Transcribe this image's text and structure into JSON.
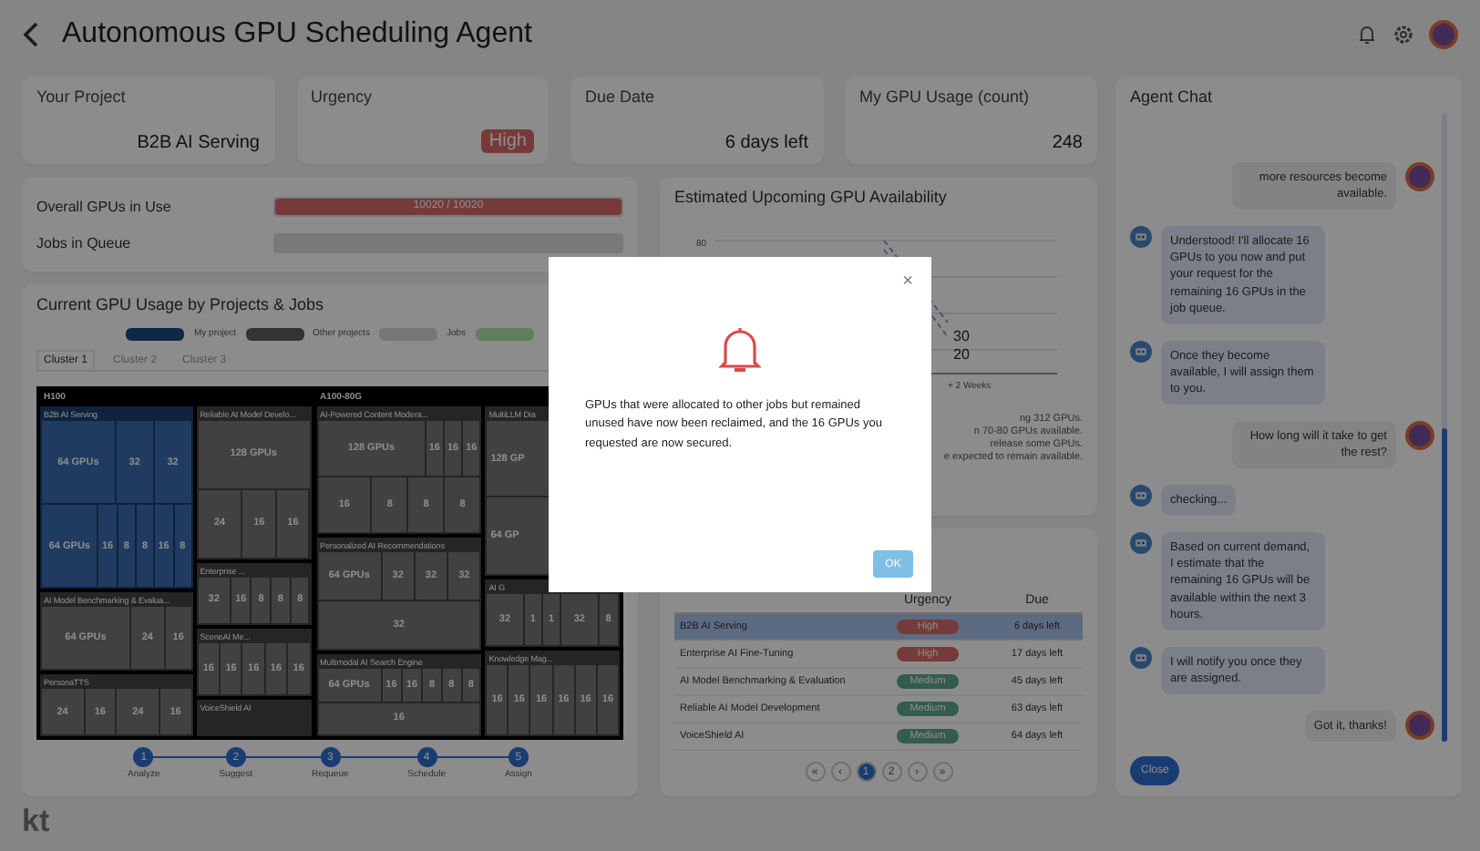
{
  "header": {
    "title": "Autonomous GPU Scheduling Agent"
  },
  "stats": [
    {
      "label": "Your Project",
      "value": "B2B AI Serving",
      "kind": "text"
    },
    {
      "label": "Urgency",
      "value": "High",
      "kind": "badge"
    },
    {
      "label": "Due Date",
      "value": "6 days left",
      "kind": "text"
    },
    {
      "label": "My GPU Usage (count)",
      "value": "248",
      "kind": "text"
    }
  ],
  "gpu_status": [
    {
      "label": "Overall GPUs in Use",
      "reading": "10020 / 10020",
      "level": 1
    },
    {
      "label": "Jobs in Queue"
    }
  ],
  "usage": {
    "title": "Current GPU Usage by Projects & Jobs",
    "legend": [
      {
        "label": "My project",
        "color": "#0f2847"
      },
      {
        "label": "Other projects",
        "color": "#333333"
      },
      {
        "label": "Jobs",
        "color": "#777777"
      },
      {
        "color": "#5f7f5f"
      }
    ],
    "tabs": [
      {
        "label": "Cluster 1",
        "selected": true
      },
      {
        "label": "Cluster 2",
        "selected": false
      },
      {
        "label": "Cluster 3",
        "selected": false
      }
    ],
    "clusters": [
      {
        "name": "H100",
        "columns": [
          [
            {
              "name": "B2B AI Serving",
              "mine": true,
              "tiles": [
                "64 GPUs",
                "32",
                "32",
                "64 GPUs",
                "16",
                "8",
                "8",
                "16",
                "8"
              ]
            },
            {
              "name": "AI Model Benchmarking & Evalua...",
              "mine": false,
              "tiles": [
                "64 GPUs",
                "24",
                "16"
              ]
            },
            {
              "name": "PersonaTTS",
              "mine": false,
              "tiles": [
                "24",
                "16",
                "24",
                "16"
              ]
            }
          ],
          [
            {
              "name": "Reliable AI Model Develo...",
              "mine": false,
              "tiles": [
                "128 GPUs",
                "24",
                "16",
                "16"
              ]
            },
            {
              "name": "Enterprise ...",
              "mine": false,
              "tiles": [
                "32",
                "16",
                "8",
                "8",
                "8"
              ]
            },
            {
              "name": "SceneAI Me...",
              "mine": false,
              "tiles": [
                "16",
                "16",
                "16",
                "16",
                "16"
              ]
            },
            {
              "name": "VoiceShield AI",
              "mine": false
            }
          ]
        ]
      },
      {
        "name": "A100-80G",
        "columns": [
          [
            {
              "name": "AI-Powered Content Modera...",
              "mine": false,
              "tiles": [
                "128 GPUs",
                "16",
                "16",
                "16",
                "16",
                "8",
                "8",
                "8"
              ]
            },
            {
              "name": "Personalized AI Recommendations",
              "mine": false,
              "tiles": [
                "64 GPUs",
                "32",
                "32",
                "32",
                "32"
              ]
            },
            {
              "name": "Multimodal AI Search Engine",
              "mine": false,
              "tiles": [
                "64 GPUs",
                "16",
                "16",
                "8",
                "8",
                "8",
                "16"
              ]
            }
          ],
          [
            {
              "name": "MultiLLM Dia",
              "mine": false,
              "tiles": [
                "128 GP",
                "64 GP"
              ]
            },
            {
              "name": "AI G",
              "mine": false,
              "tiles": [
                "32",
                "1",
                "1",
                "32",
                "8"
              ]
            },
            {
              "name": "Knowledge Mag...",
              "mine": false,
              "tiles": [
                "16",
                "16",
                "16",
                "16",
                "16",
                "16"
              ]
            }
          ]
        ]
      }
    ],
    "steps": [
      {
        "number": "1",
        "label": "Analyze"
      },
      {
        "number": "2",
        "label": "Suggest"
      },
      {
        "number": "3",
        "label": "Requeue"
      },
      {
        "number": "4",
        "label": "Schedule"
      },
      {
        "number": "5",
        "label": "Assign"
      }
    ]
  },
  "availability": {
    "title": "Estimated Upcoming GPU Availability",
    "ytick": "80",
    "point_labels": [
      "30",
      "20"
    ],
    "xtick": "+ 2 Weeks",
    "notes": [
      "ng 312 GPUs.",
      "n 70-80 GPUs available.",
      "release some GPUs.",
      "e expected to remain available."
    ]
  },
  "queue": {
    "columns": [
      "Urgency",
      "Due"
    ],
    "rows": [
      {
        "project": "B2B AI Serving",
        "urgency": "High",
        "kind": "high",
        "due": "6 days left",
        "selected": true
      },
      {
        "project": "Enterprise AI Fine-Tuning",
        "urgency": "High",
        "kind": "high",
        "due": "17 days left",
        "selected": false
      },
      {
        "project": "AI Model Benchmarking & Evaluation",
        "urgency": "Medium",
        "kind": "medium",
        "due": "45 days left",
        "selected": false
      },
      {
        "project": "Reliable AI Model Development",
        "urgency": "Medium",
        "kind": "medium",
        "due": "63 days left",
        "selected": false
      },
      {
        "project": "VoiceShield AI",
        "urgency": "Medium",
        "kind": "medium",
        "due": "64 days left",
        "selected": false
      }
    ],
    "pages": [
      {
        "label": "«",
        "selected": false
      },
      {
        "label": "‹",
        "selected": false
      },
      {
        "label": "1",
        "selected": true
      },
      {
        "label": "2",
        "selected": false
      },
      {
        "label": "›",
        "selected": false
      },
      {
        "label": "»",
        "selected": false
      }
    ]
  },
  "chat": {
    "title": "Agent Chat",
    "messages": [
      {
        "kind": "user",
        "text": "more resources become available."
      },
      {
        "kind": "agent",
        "text": "Understood! I'll allocate 16 GPUs to you now and put your request for the remaining 16 GPUs in the job queue."
      },
      {
        "kind": "agent",
        "text": "Once they become available, I will assign them to you."
      },
      {
        "kind": "user",
        "text": "How long will it take to get the rest?"
      },
      {
        "kind": "agent",
        "text": "checking..."
      },
      {
        "kind": "agent",
        "text": "Based on current demand, I estimate that the remaining 16 GPUs will be available within the next 3 hours."
      },
      {
        "kind": "agent",
        "text": "I will notify you once they are assigned."
      },
      {
        "kind": "user",
        "text": "Got it, thanks!"
      }
    ],
    "button": "Close"
  },
  "footer": {
    "logo": "kt"
  },
  "modal": {
    "close": "×",
    "message": "GPUs that were allocated to other jobs but remained unused have now been reclaimed, and the 16 GPUs you requested are now secured.",
    "button": "OK"
  }
}
